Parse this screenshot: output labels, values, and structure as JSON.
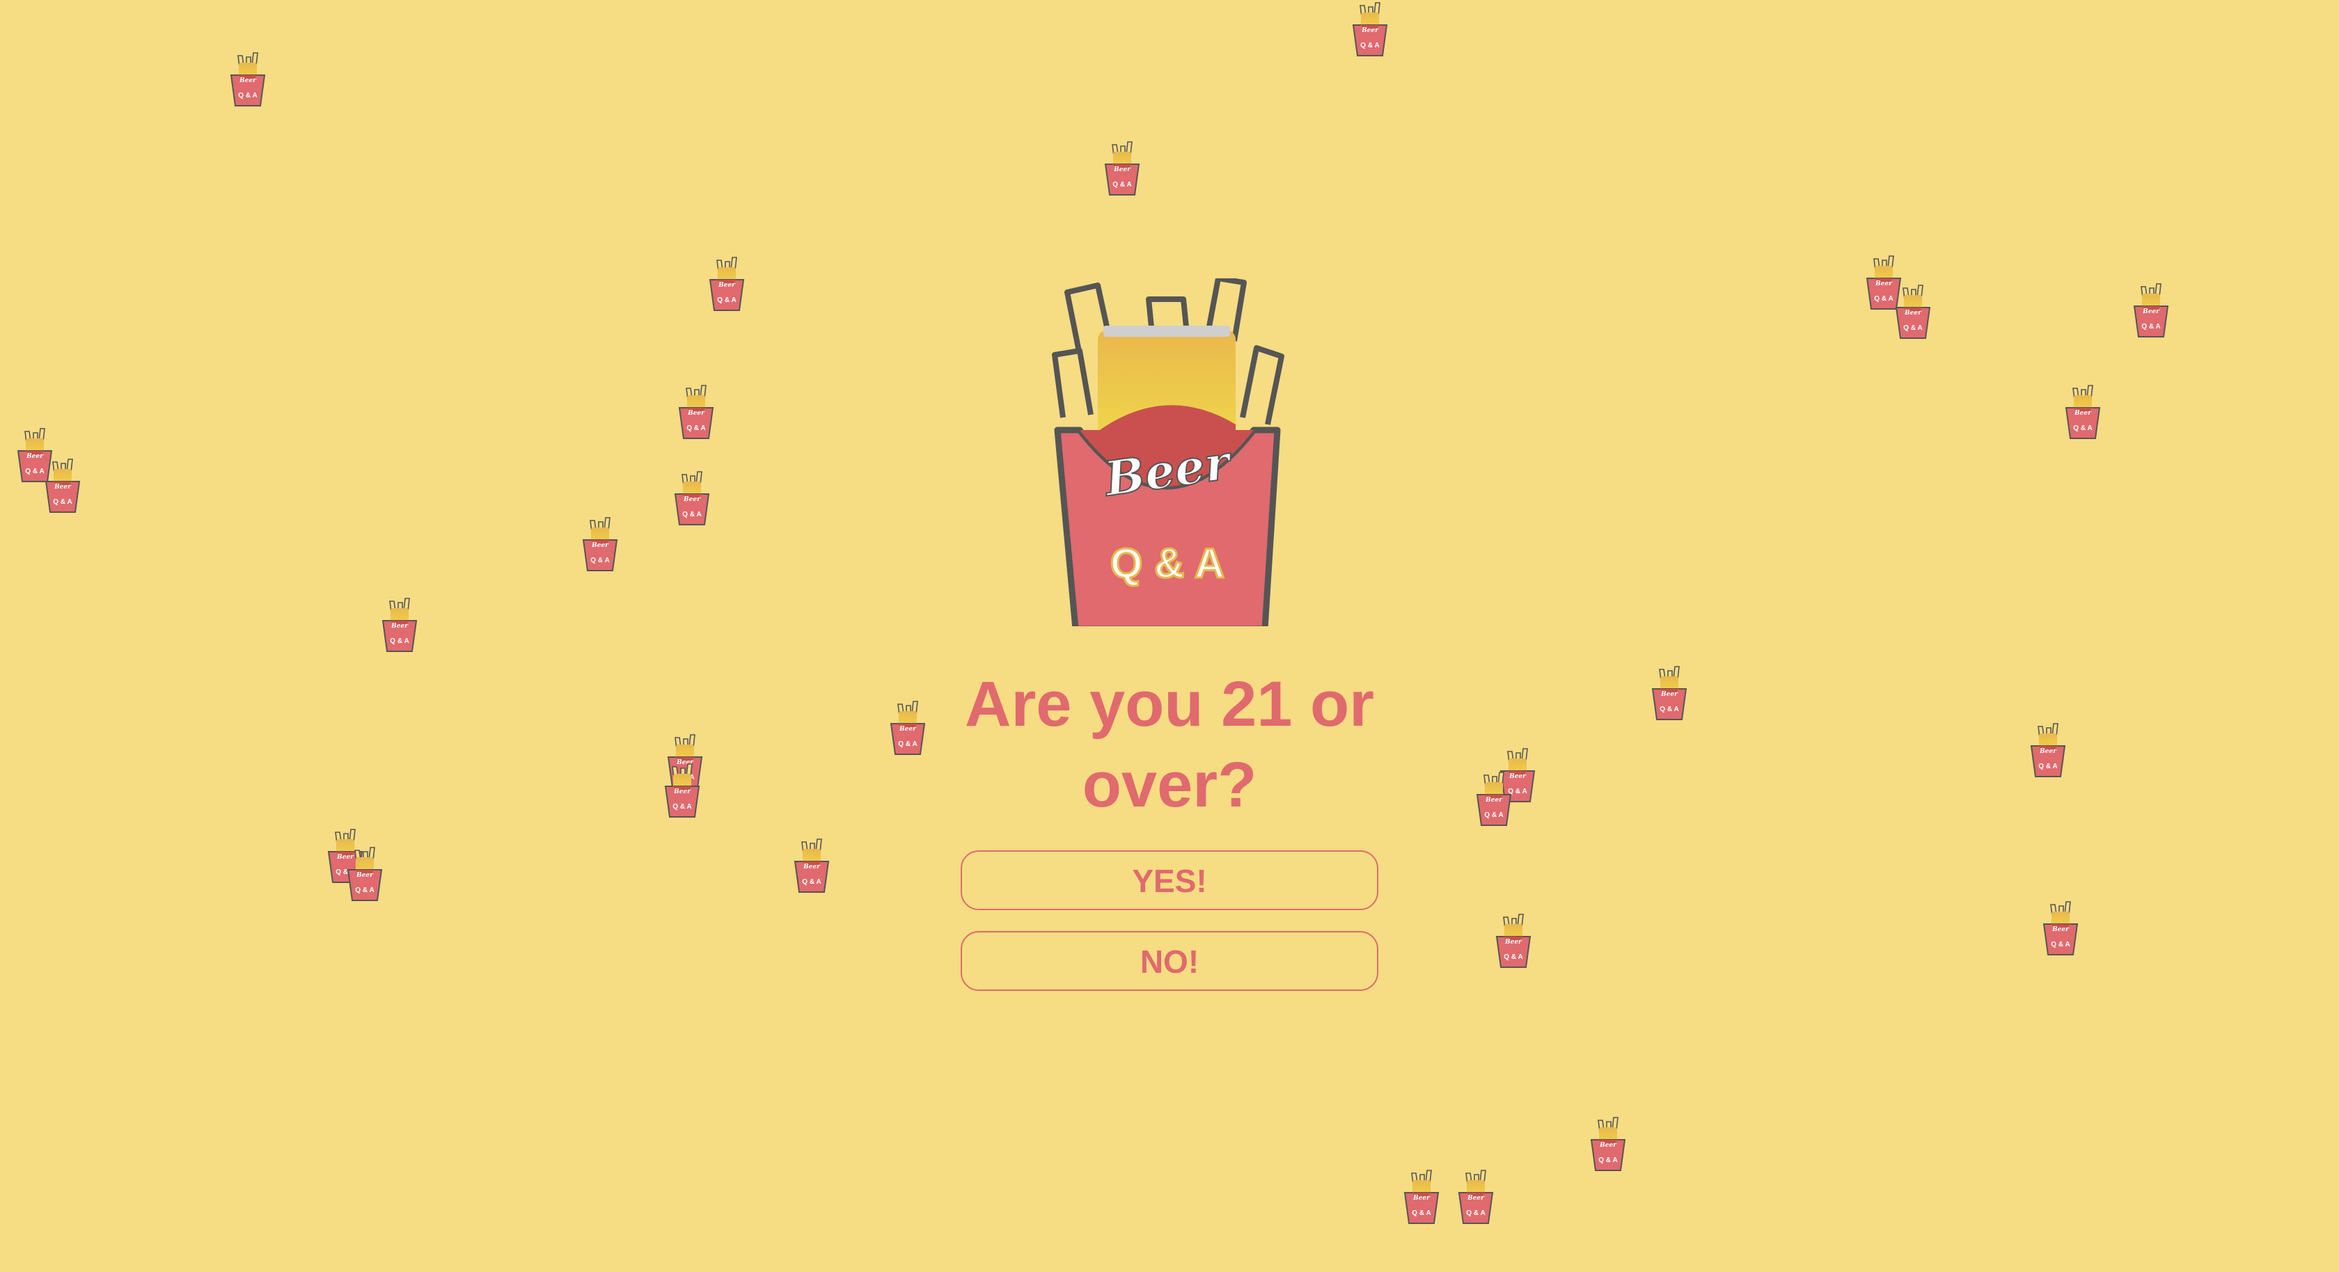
{
  "logo": {
    "brand_text": "Beer",
    "sub_text": "Q & A",
    "icon": "beer-fries-box-logo"
  },
  "age_gate": {
    "question": "Are you 21 or over?",
    "yes_label": "YES!",
    "no_label": "NO!"
  },
  "background": {
    "pattern_icon": "mini-beer-box-icon",
    "icon_text": "Beer"
  },
  "colors": {
    "background": "#f6dc83",
    "accent": "#e06a6e",
    "box_dark": "#c9504f",
    "outline": "#555555",
    "beer_light": "#f1d54a",
    "beer_top": "#e9b84c"
  }
}
